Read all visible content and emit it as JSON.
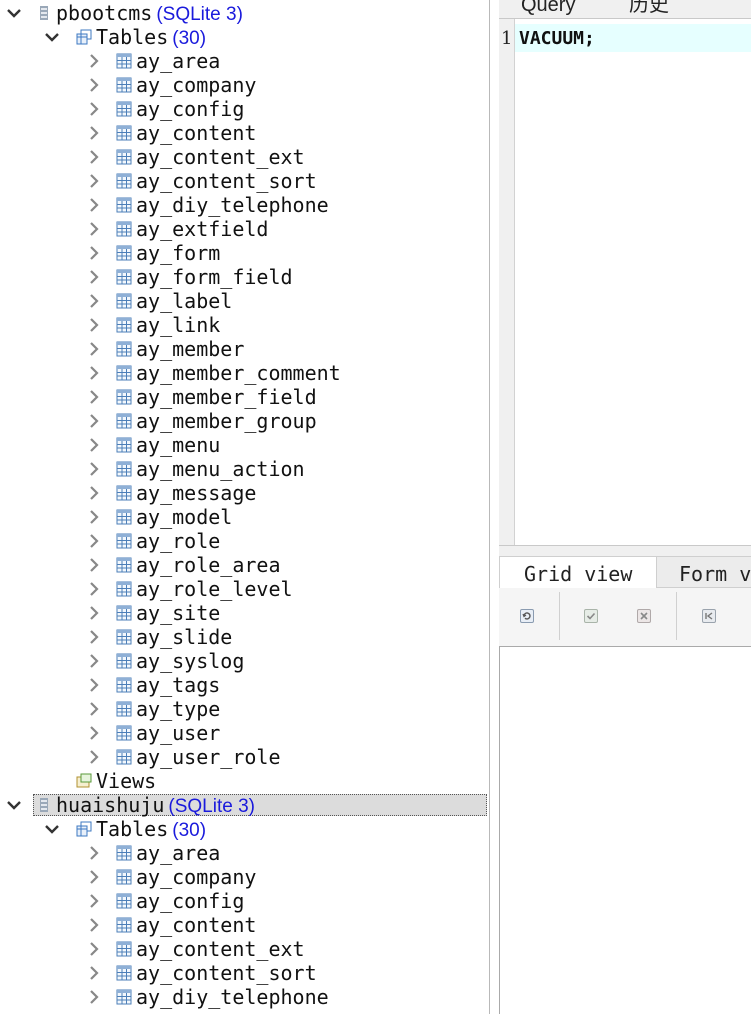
{
  "tree": {
    "db1": {
      "name": "pbootcms",
      "type": "(SQLite 3)",
      "tables_label": "Tables",
      "tables_count": "(30)",
      "tables": [
        "ay_area",
        "ay_company",
        "ay_config",
        "ay_content",
        "ay_content_ext",
        "ay_content_sort",
        "ay_diy_telephone",
        "ay_extfield",
        "ay_form",
        "ay_form_field",
        "ay_label",
        "ay_link",
        "ay_member",
        "ay_member_comment",
        "ay_member_field",
        "ay_member_group",
        "ay_menu",
        "ay_menu_action",
        "ay_message",
        "ay_model",
        "ay_role",
        "ay_role_area",
        "ay_role_level",
        "ay_site",
        "ay_slide",
        "ay_syslog",
        "ay_tags",
        "ay_type",
        "ay_user",
        "ay_user_role"
      ],
      "views_label": "Views"
    },
    "db2": {
      "name": "huaishuju",
      "type": "(SQLite 3)",
      "tables_label": "Tables",
      "tables_count": "(30)",
      "tables": [
        "ay_area",
        "ay_company",
        "ay_config",
        "ay_content",
        "ay_content_ext",
        "ay_content_sort",
        "ay_diy_telephone"
      ]
    }
  },
  "query_tabs": [
    "Query",
    "历史"
  ],
  "editor": {
    "line_number": "1",
    "code": "VACUUM;"
  },
  "result_tabs": [
    "Grid view",
    "Form v"
  ],
  "toolbar": {
    "buttons": [
      "refresh-icon",
      "commit-icon",
      "rollback-icon",
      "first-record-icon"
    ]
  },
  "colors": {
    "db_type": "#1a1adc",
    "current_line": "#e6ffff",
    "selection": "#dcdcdc"
  }
}
